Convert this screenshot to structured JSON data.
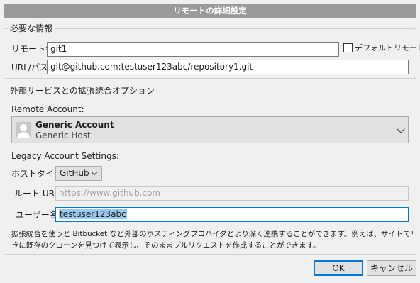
{
  "dialog": {
    "title": "リモートの詳細設定"
  },
  "required": {
    "legend": "必要な情報",
    "remote_name_label": "リモート名:",
    "remote_name_value": "git1",
    "default_remote_label": "デフォルトリモート",
    "default_remote_checked": false,
    "url_label": "URL/パス:",
    "url_value": "git@github.com:testuser123abc/repository1.git"
  },
  "integration": {
    "legend": "外部サービスとの拡張統合オプション",
    "remote_account_label": "Remote Account:",
    "account": {
      "name": "Generic Account",
      "host": "Generic Host"
    },
    "legacy_label": "Legacy Account Settings:",
    "host_type_label": "ホストタイプ:",
    "host_type_value": "GitHub",
    "root_url_label": "ルート URL:",
    "root_url_value": "https://www.github.com",
    "username_label": "ユーザー名:",
    "username_value": "testuser123abc",
    "info_line1": "拡張統合を使うと Bitbucket など外部のホスティングプロバイダとより深く連携することができます。例えば、サイトでリンクを開いたと",
    "info_line2": "きに既存のクローンを見つけて表示し、そのままプルリクエストを作成することができます。"
  },
  "buttons": {
    "ok": "OK",
    "cancel": "キャンセル"
  },
  "colors": {
    "accent": "#0078d7",
    "selection": "#99c9ef",
    "titlebar": "#9a9a9a"
  }
}
